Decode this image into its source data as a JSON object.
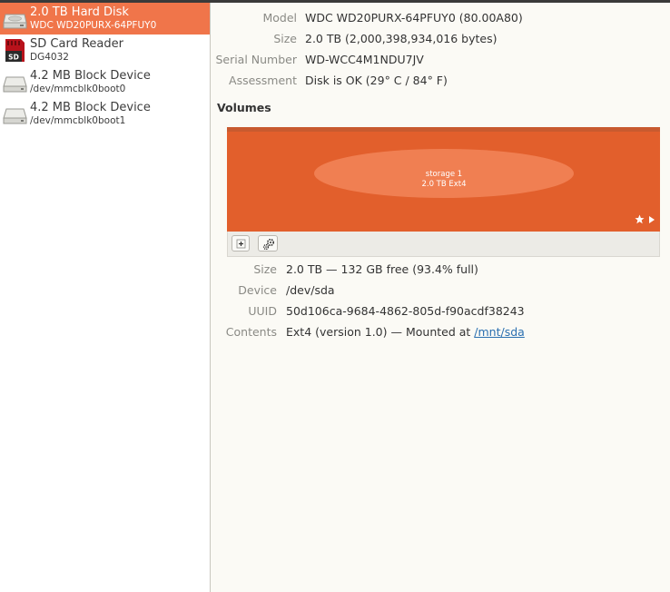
{
  "devices": [
    {
      "title": "2.0 TB Hard Disk",
      "subtitle": "WDC WD20PURX-64PFUY0",
      "icon": "hard-disk-icon",
      "selected": true
    },
    {
      "title": "SD Card Reader",
      "subtitle": "DG4032",
      "icon": "sd-card-icon",
      "selected": false
    },
    {
      "title": "4.2 MB Block Device",
      "subtitle": "/dev/mmcblk0boot0",
      "icon": "block-device-icon",
      "selected": false
    },
    {
      "title": "4.2 MB Block Device",
      "subtitle": "/dev/mmcblk0boot1",
      "icon": "block-device-icon",
      "selected": false
    }
  ],
  "disk": {
    "model_label": "Model",
    "model": "WDC WD20PURX-64PFUY0 (80.00A80)",
    "size_label": "Size",
    "size": "2.0 TB (2,000,398,934,016 bytes)",
    "serial_label": "Serial Number",
    "serial": "WD-WCC4M1NDU7JV",
    "assessment_label": "Assessment",
    "assessment": "Disk is OK (29° C / 84° F)"
  },
  "volumes": {
    "heading": "Volumes",
    "partition": {
      "name": "storage 1",
      "size_fs": "2.0 TB Ext4"
    },
    "toolbar": {
      "add_icon": "plus-icon",
      "settings_icon": "gears-icon"
    }
  },
  "partition_info": {
    "size_label": "Size",
    "size": "2.0 TB — 132 GB free (93.4% full)",
    "device_label": "Device",
    "device": "/dev/sda",
    "uuid_label": "UUID",
    "uuid": "50d106ca-9684-4862-805d-f90acdf38243",
    "contents_label": "Contents",
    "contents_prefix": "Ext4 (version 1.0) — Mounted at ",
    "mount_link": "/mnt/sda"
  },
  "colors": {
    "accent": "#f0754a",
    "partition": "#e25f2c",
    "link": "#2a6fb0"
  }
}
